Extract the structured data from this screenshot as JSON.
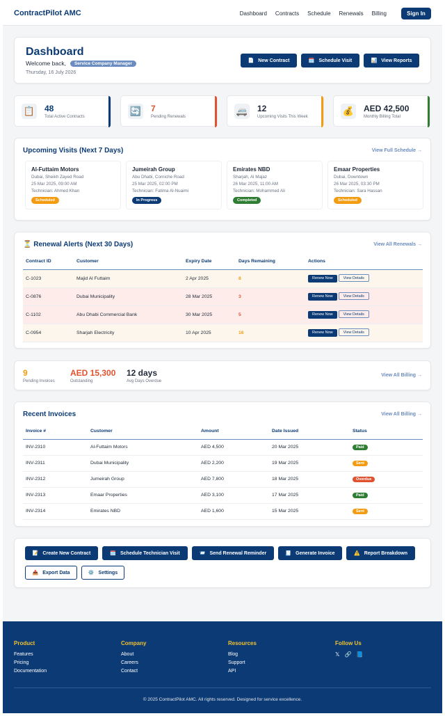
{
  "nav": {
    "brand": "ContractPilot AMC",
    "links": [
      "Dashboard",
      "Contracts",
      "Schedule",
      "Renewals",
      "Billing"
    ],
    "signin": "Sign In"
  },
  "header": {
    "title": "Dashboard",
    "welcome": "Welcome back,",
    "role": "Service Company Manager",
    "date": "Thursday, 16 July 2026",
    "buttons": [
      {
        "icon": "📄",
        "label": "New Contract"
      },
      {
        "icon": "🗓️",
        "label": "Schedule Visit"
      },
      {
        "icon": "📊",
        "label": "View Reports"
      }
    ]
  },
  "stats": [
    {
      "icon": "📋",
      "value": "48",
      "label": "Total Active Contracts",
      "color": "#0b3a75",
      "accent": "#0b3a75"
    },
    {
      "icon": "🔄",
      "value": "7",
      "label": "Pending Renewals",
      "color": "#e0522f",
      "accent": "#e0522f"
    },
    {
      "icon": "🚐",
      "value": "12",
      "label": "Upcoming Visits This Week",
      "color": "#1f2937",
      "accent": "#f39c12"
    },
    {
      "icon": "💰",
      "value": "AED 42,500",
      "label": "Monthly Billing Total",
      "color": "#1f2937",
      "accent": "#2e7d32"
    }
  ],
  "visits": {
    "title": "Upcoming Visits (Next 7 Days)",
    "link": "View Full Schedule →",
    "items": [
      {
        "name": "Al-Futtaim Motors",
        "location": "Dubai, Sheikh Zayed Road",
        "time": "25 Mar 2025, 09:00 AM",
        "tech": "Technician: Ahmed Khan",
        "status": "Scheduled",
        "status_color": "#f39c12"
      },
      {
        "name": "Jumeirah Group",
        "location": "Abu Dhabi, Corniche Road",
        "time": "25 Mar 2025, 02:00 PM",
        "tech": "Technician: Fatima Al-Nuaimi",
        "status": "In Progress",
        "status_color": "#0b3a75"
      },
      {
        "name": "Emirates NBD",
        "location": "Sharjah, Al Majaz",
        "time": "26 Mar 2025, 11:00 AM",
        "tech": "Technician: Mohammed Ali",
        "status": "Completed",
        "status_color": "#2e7d32"
      },
      {
        "name": "Emaar Properties",
        "location": "Dubai, Downtown",
        "time": "26 Mar 2025, 03:30 PM",
        "tech": "Technician: Sara Hassan",
        "status": "Scheduled",
        "status_color": "#f39c12"
      }
    ]
  },
  "renewals": {
    "icon": "⏳",
    "title": "Renewal Alerts (Next 30 Days)",
    "link": "View All Renewals →",
    "columns": [
      "Contract ID",
      "Customer",
      "Expiry Date",
      "Days Remaining",
      "Actions"
    ],
    "renew_label": "Renew Now",
    "details_label": "View Details",
    "rows": [
      {
        "id": "C-1023",
        "customer": "Majid Al Futtaim",
        "expiry": "2 Apr 2025",
        "days": "8",
        "bg": "#fdf6ec",
        "days_color": "#f39c12"
      },
      {
        "id": "C-0876",
        "customer": "Dubai Municipality",
        "expiry": "28 Mar 2025",
        "days": "3",
        "bg": "#fdecea",
        "days_color": "#e0522f"
      },
      {
        "id": "C-1102",
        "customer": "Abu Dhabi Commercial Bank",
        "expiry": "30 Mar 2025",
        "days": "5",
        "bg": "#fdecea",
        "days_color": "#e0522f"
      },
      {
        "id": "C-0954",
        "customer": "Sharjah Electricity",
        "expiry": "10 Apr 2025",
        "days": "16",
        "bg": "#fdf6ec",
        "days_color": "#f39c12"
      }
    ]
  },
  "billing_summary": {
    "pending_value": "9",
    "pending_label": "Pending Invoices",
    "outstanding_value": "AED 15,300",
    "outstanding_label": "Outstanding",
    "overdue_value": "12 days",
    "overdue_label": "Avg Days Overdue",
    "link": "View All Billing →"
  },
  "invoices": {
    "title": "Recent Invoices",
    "link": "View All Billing →",
    "columns": [
      "Invoice #",
      "Customer",
      "Amount",
      "Date Issued",
      "Status"
    ],
    "rows": [
      {
        "id": "INV-2310",
        "customer": "Al-Futtaim Motors",
        "amount": "AED 4,500",
        "date": "20 Mar 2025",
        "status": "Paid",
        "status_color": "#2e7d32"
      },
      {
        "id": "INV-2311",
        "customer": "Dubai Municipality",
        "amount": "AED 2,200",
        "date": "19 Mar 2025",
        "status": "Sent",
        "status_color": "#f39c12"
      },
      {
        "id": "INV-2312",
        "customer": "Jumeirah Group",
        "amount": "AED 7,800",
        "date": "18 Mar 2025",
        "status": "Overdue",
        "status_color": "#e0522f"
      },
      {
        "id": "INV-2313",
        "customer": "Emaar Properties",
        "amount": "AED 3,100",
        "date": "17 Mar 2025",
        "status": "Paid",
        "status_color": "#2e7d32"
      },
      {
        "id": "INV-2314",
        "customer": "Emirates NBD",
        "amount": "AED 1,600",
        "date": "15 Mar 2025",
        "status": "Sent",
        "status_color": "#f39c12"
      }
    ]
  },
  "quick_actions": [
    {
      "icon": "📝",
      "label": "Create New Contract",
      "style": "primary"
    },
    {
      "icon": "🗓️",
      "label": "Schedule Technician Visit",
      "style": "primary"
    },
    {
      "icon": "📨",
      "label": "Send Renewal Reminder",
      "style": "primary"
    },
    {
      "icon": "🧾",
      "label": "Generate Invoice",
      "style": "primary"
    },
    {
      "icon": "⚠️",
      "label": "Report Breakdown",
      "style": "primary"
    },
    {
      "icon": "📤",
      "label": "Export Data",
      "style": "outline"
    },
    {
      "icon": "⚙️",
      "label": "Settings",
      "style": "outline"
    }
  ],
  "footer": {
    "columns": [
      {
        "title": "Product",
        "links": [
          "Features",
          "Pricing",
          "Documentation"
        ]
      },
      {
        "title": "Company",
        "links": [
          "About",
          "Careers",
          "Contact"
        ]
      },
      {
        "title": "Resources",
        "links": [
          "Blog",
          "Support",
          "API"
        ]
      },
      {
        "title": "Follow Us",
        "links": []
      }
    ],
    "social_icons": [
      "𝕏",
      "🔗",
      "📘"
    ],
    "copyright": "© 2025 ContractPilot AMC. All rights reserved. Designed for service excellence."
  }
}
